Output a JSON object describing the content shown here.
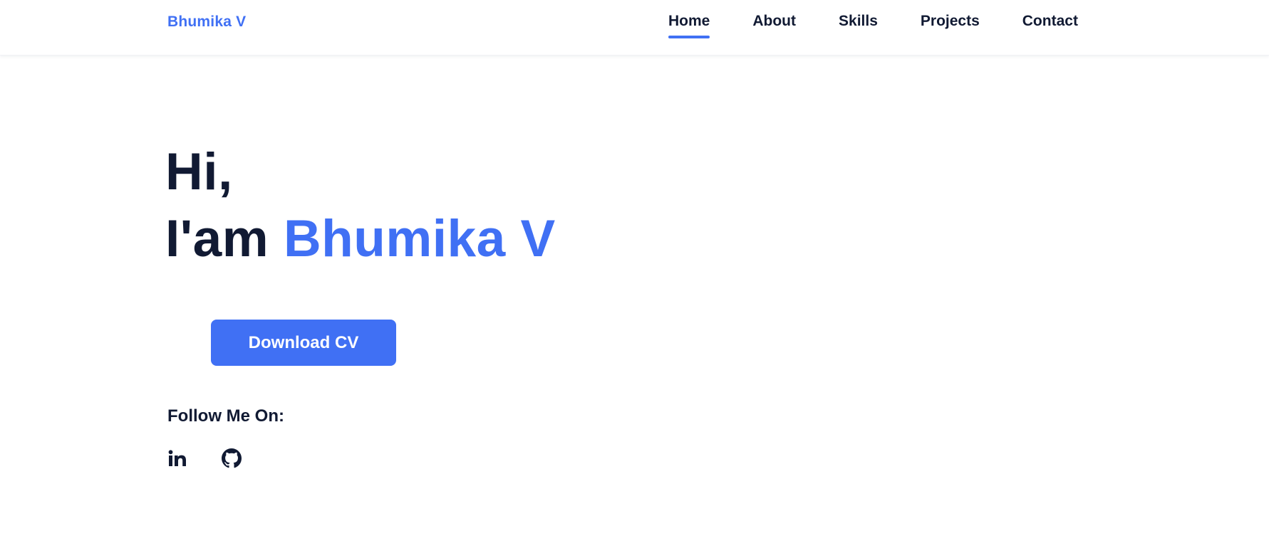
{
  "header": {
    "logo": "Bhumika V",
    "nav": [
      {
        "label": "Home",
        "active": true
      },
      {
        "label": "About",
        "active": false
      },
      {
        "label": "Skills",
        "active": false
      },
      {
        "label": "Projects",
        "active": false
      },
      {
        "label": "Contact",
        "active": false
      }
    ]
  },
  "hero": {
    "greeting": "Hi,",
    "intro_prefix": "I'am ",
    "name": "Bhumika V",
    "cv_button": "Download CV",
    "follow_label": "Follow Me On:",
    "socials": [
      {
        "icon": "linkedin-icon"
      },
      {
        "icon": "github-icon"
      }
    ]
  },
  "colors": {
    "accent": "#4070f4",
    "text": "#111a33",
    "background": "#ffffff"
  }
}
